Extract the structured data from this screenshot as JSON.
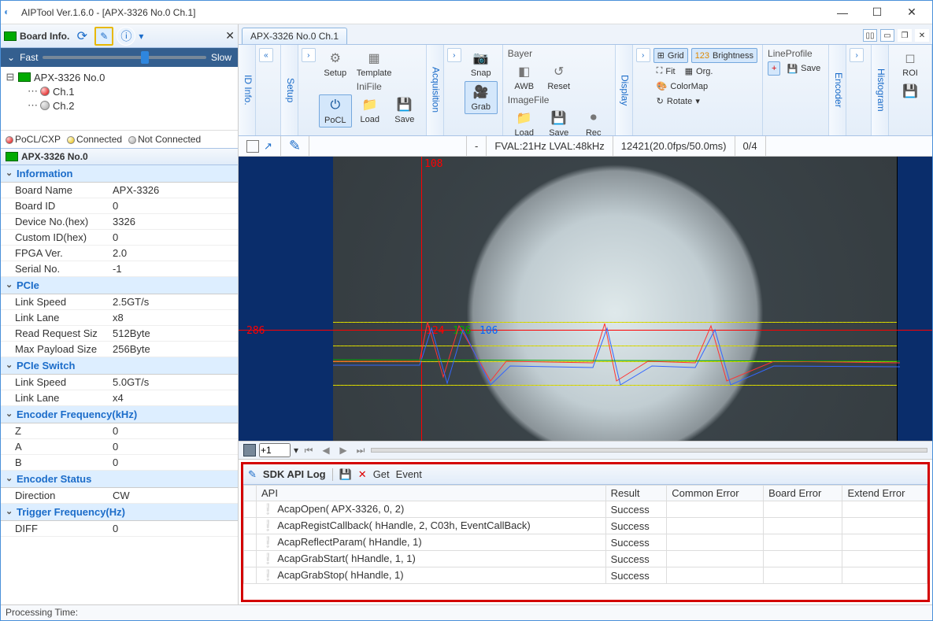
{
  "window": {
    "title": "AIPTool Ver.1.6.0 - [APX-3326 No.0 Ch.1]"
  },
  "left": {
    "header": "Board Info.",
    "speed_fast": "Fast",
    "speed_slow": "Slow",
    "tree_board": "APX-3326 No.0",
    "tree_ch1": "Ch.1",
    "tree_ch2": "Ch.2",
    "legend_pocl": "PoCL/CXP",
    "legend_conn": "Connected",
    "legend_nc": "Not Connected",
    "selected": "APX-3326 No.0",
    "sections": [
      {
        "title": "Information",
        "rows": [
          [
            "Board Name",
            "APX-3326"
          ],
          [
            "Board ID",
            "0"
          ],
          [
            "Device No.(hex)",
            "3326"
          ],
          [
            "Custom ID(hex)",
            "0"
          ],
          [
            "FPGA Ver.",
            "2.0"
          ],
          [
            "Serial No.",
            "-1"
          ]
        ]
      },
      {
        "title": "PCIe",
        "rows": [
          [
            "Link Speed",
            "2.5GT/s"
          ],
          [
            "Link Lane",
            "x8"
          ],
          [
            "Read Request Siz",
            "512Byte"
          ],
          [
            "Max Payload Size",
            "256Byte"
          ]
        ]
      },
      {
        "title": "PCIe Switch",
        "rows": [
          [
            "Link Speed",
            "5.0GT/s"
          ],
          [
            "Link Lane",
            "x4"
          ]
        ]
      },
      {
        "title": "Encoder Frequency(kHz)",
        "rows": [
          [
            "Z",
            "0"
          ],
          [
            "A",
            "0"
          ],
          [
            "B",
            "0"
          ]
        ]
      },
      {
        "title": "Encoder Status",
        "rows": [
          [
            "Direction",
            "CW"
          ]
        ]
      },
      {
        "title": "Trigger Frequency(Hz)",
        "rows": [
          [
            "DIFF",
            "0"
          ]
        ]
      }
    ]
  },
  "tab": {
    "name": "APX-3326 No.0 Ch.1"
  },
  "ribbon": {
    "vtab_info": "ID Info.",
    "vtab_setup": "Setup",
    "vtab_acq": "Acquisition",
    "vtab_disp": "Display",
    "vtab_enc": "Encoder",
    "vtab_hist": "Histogram",
    "setup": "Setup",
    "template": "Template",
    "inifile": "IniFile",
    "pocl": "PoCL",
    "load": "Load",
    "save": "Save",
    "snap": "Snap",
    "grab": "Grab",
    "bayer": "Bayer",
    "awb": "AWB",
    "reset": "Reset",
    "imagefile": "ImageFile",
    "rec": "Rec",
    "grid": "Grid",
    "brightness": "Brightness",
    "fit": "Fit",
    "org": "Org.",
    "colormap": "ColorMap",
    "rotate": "Rotate",
    "lineprofile": "LineProfile",
    "plus": "+",
    "roi": "ROI"
  },
  "status": {
    "dash": "-",
    "fval": "FVAL:21Hz  LVAL:48kHz",
    "frames": "12421(20.0fps/50.0ms)",
    "count": "0/4"
  },
  "overlay": {
    "y108": "108",
    "y286": "286",
    "v124": "124",
    "v126": "126",
    "v106": "106"
  },
  "playback": {
    "zoom": "+1"
  },
  "sdk": {
    "title": "SDK API Log",
    "get": "Get",
    "event": "Event",
    "cols": [
      "",
      "API",
      "Result",
      "Common Error",
      "Board Error",
      "Extend Error"
    ],
    "rows": [
      [
        "AcapOpen( APX-3326, 0, 2)",
        "Success",
        "",
        "",
        ""
      ],
      [
        "AcapRegistCallback( hHandle, 2, C03h, EventCallBack)",
        "Success",
        "",
        "",
        ""
      ],
      [
        "AcapReflectParam( hHandle, 1)",
        "Success",
        "",
        "",
        ""
      ],
      [
        "AcapGrabStart( hHandle, 1, 1)",
        "Success",
        "",
        "",
        ""
      ],
      [
        "AcapGrabStop( hHandle, 1)",
        "Success",
        "",
        "",
        ""
      ]
    ]
  },
  "statusbar": "Processing Time:"
}
